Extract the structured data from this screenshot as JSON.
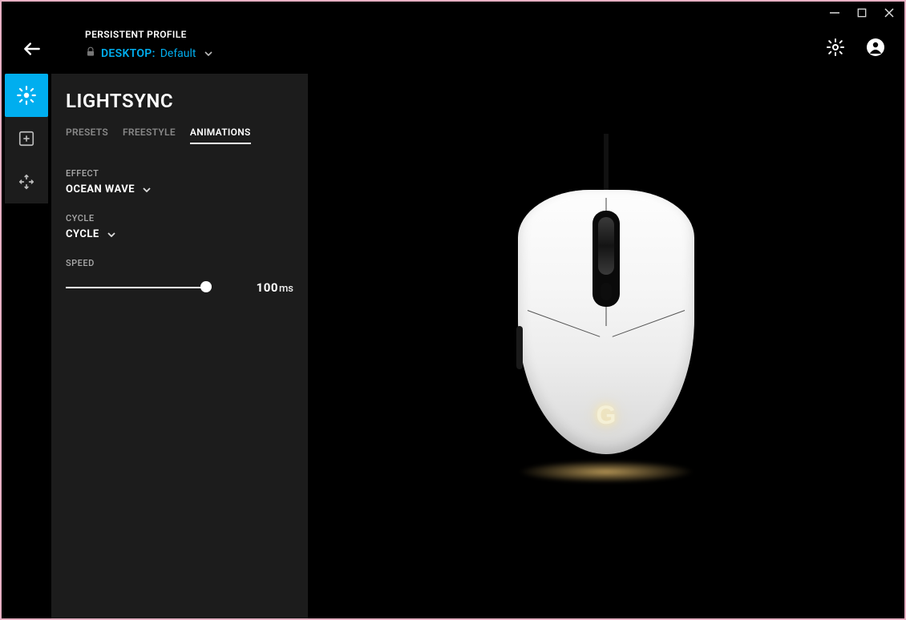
{
  "profile": {
    "label": "PERSISTENT PROFILE",
    "desktop": "DESKTOP:",
    "default": "Default"
  },
  "panel": {
    "title": "LIGHTSYNC",
    "tabs": {
      "presets": "PRESETS",
      "freestyle": "FREESTYLE",
      "animations": "ANIMATIONS"
    },
    "effect": {
      "label": "EFFECT",
      "value": "OCEAN WAVE"
    },
    "cycle": {
      "label": "CYCLE",
      "value": "CYCLE"
    },
    "speed": {
      "label": "SPEED",
      "value": "100",
      "unit": "ms"
    }
  }
}
